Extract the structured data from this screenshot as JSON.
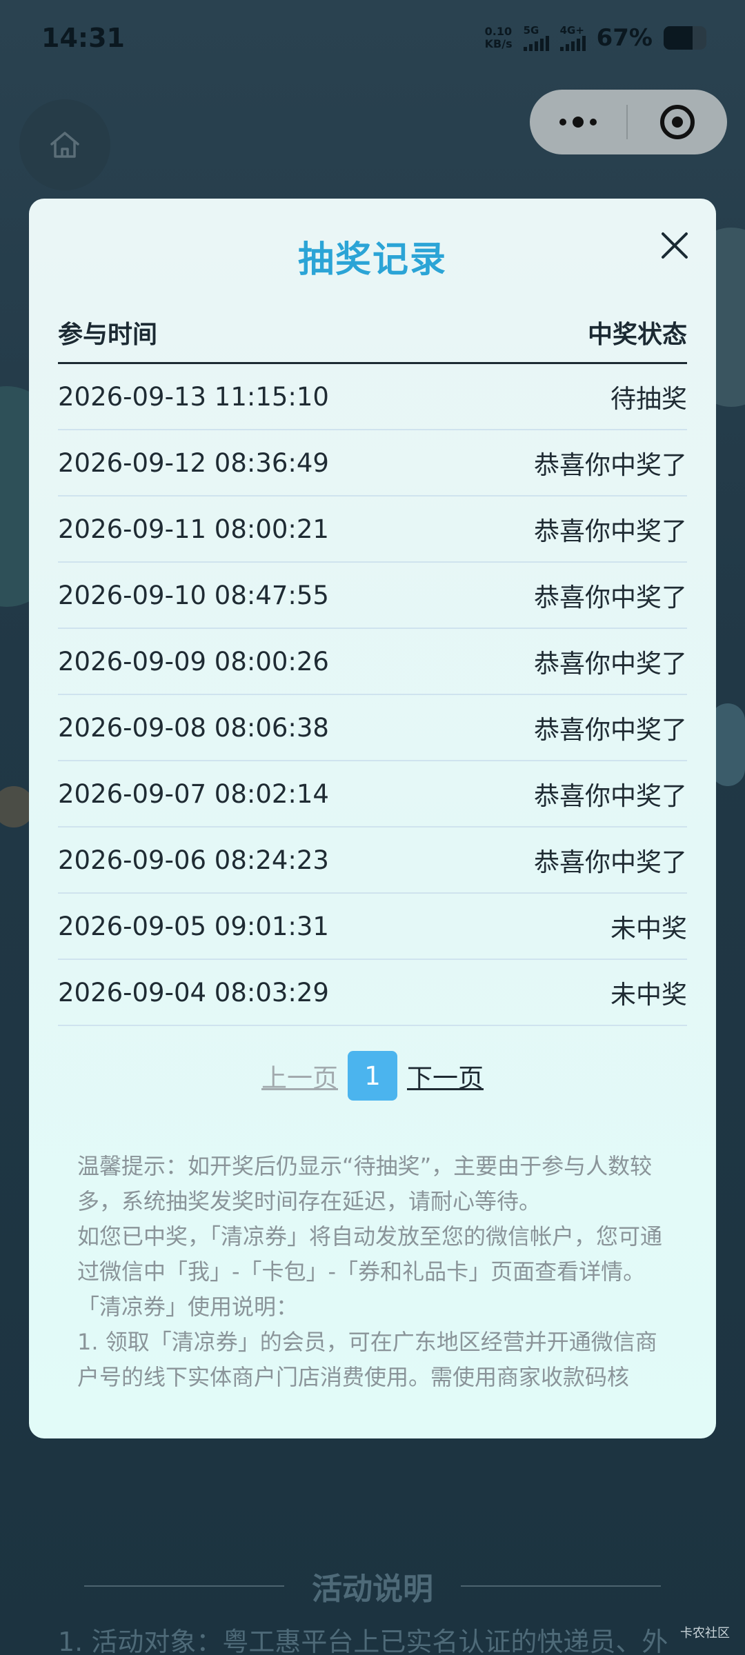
{
  "status_bar": {
    "time": "14:31",
    "net_speed_value": "0.10",
    "net_speed_unit": "KB/s",
    "sim1_label": "5G",
    "sim2_label": "4G+",
    "battery_text": "67%",
    "battery_level": 0.67
  },
  "top_bar": {
    "home_icon": "home-icon",
    "more_icon": "more-dots-icon",
    "close_icon": "target-circle-icon"
  },
  "modal": {
    "title": "抽奖记录",
    "close_icon": "close-icon",
    "columns": {
      "time": "参与时间",
      "status": "中奖状态"
    },
    "rows": [
      {
        "time": "2026-09-13 11:15:10",
        "status": "待抽奖"
      },
      {
        "time": "2026-09-12 08:36:49",
        "status": "恭喜你中奖了"
      },
      {
        "time": "2026-09-11 08:00:21",
        "status": "恭喜你中奖了"
      },
      {
        "time": "2026-09-10 08:47:55",
        "status": "恭喜你中奖了"
      },
      {
        "time": "2026-09-09 08:00:26",
        "status": "恭喜你中奖了"
      },
      {
        "time": "2026-09-08 08:06:38",
        "status": "恭喜你中奖了"
      },
      {
        "time": "2026-09-07 08:02:14",
        "status": "恭喜你中奖了"
      },
      {
        "time": "2026-09-06 08:24:23",
        "status": "恭喜你中奖了"
      },
      {
        "time": "2026-09-05 09:01:31",
        "status": "未中奖"
      },
      {
        "time": "2026-09-04 08:03:29",
        "status": "未中奖"
      }
    ],
    "pager": {
      "prev": "上一页",
      "current": "1",
      "next": "下一页"
    },
    "tips": [
      "温馨提示：如开奖后仍显示“待抽奖”，主要由于参与人数较多，系统抽奖发奖时间存在延迟，请耐心等待。",
      "如您已中奖，「清凉券」将自动发放至您的微信帐户，您可通过微信中「我」-「卡包」-「券和礼品卡」页面查看详情。",
      "「清凉券」使用说明：",
      "1. 领取「清凉券」的会员，可在广东地区经营并开通微信商户号的线下实体商户门店消费使用。需使用商家收款码核"
    ]
  },
  "background": {
    "section_title": "活动说明",
    "description": "1. 活动对象：粤工惠平台上已实名认证的快递员、外"
  },
  "watermark": "卡农社区",
  "colors": {
    "title_accent": "#2ba4d6",
    "pager_active": "#4bb4ee"
  }
}
